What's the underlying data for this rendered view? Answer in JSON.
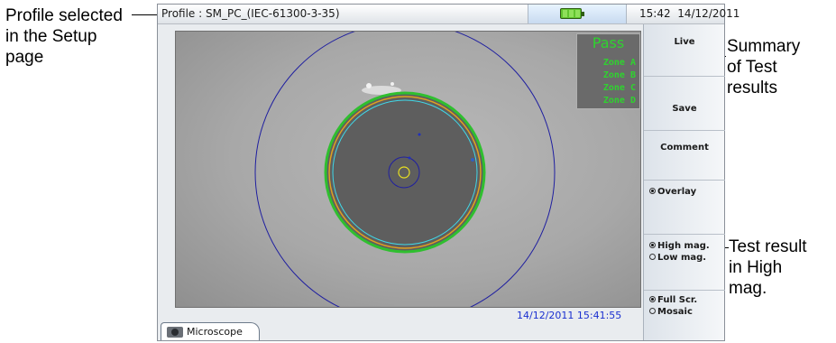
{
  "callouts": {
    "profile": [
      "Profile selected",
      "in the Setup",
      "page"
    ],
    "summary": [
      "Summary",
      "of Test",
      "results"
    ],
    "test_result": [
      "Test result",
      "in High",
      "mag."
    ]
  },
  "titlebar": {
    "profile_text": "Profile : SM_PC_(IEC-61300-3-35)",
    "time": "15:42",
    "date": "14/12/2011"
  },
  "result": {
    "status": "Pass",
    "zones": [
      "Zone A",
      "Zone B",
      "Zone C",
      "Zone D"
    ],
    "status_color": "#2fd32f"
  },
  "viewport": {
    "timestamp": "14/12/2011 15:41:55"
  },
  "tab": {
    "label": "Microscope"
  },
  "buttons": {
    "live": "Live",
    "save": "Save",
    "comment": "Comment"
  },
  "options": {
    "overlay": "Overlay",
    "high_mag": "High mag.",
    "low_mag": "Low mag.",
    "full_scr": "Full Scr.",
    "mosaic": "Mosaic"
  }
}
